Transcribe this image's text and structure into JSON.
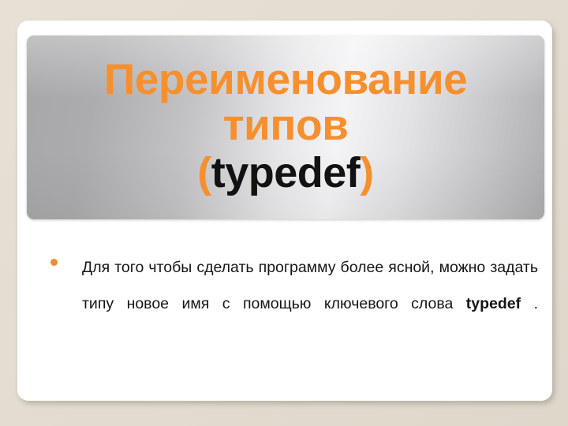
{
  "slide": {
    "background_color": "#e3ddd1",
    "card_color": "#ffffff",
    "accent_color": "#f6902f",
    "title_plate_gradient_from": "#a7a7a9",
    "title_plate_gradient_to": "#f4f4f6"
  },
  "title": {
    "line1": "Переименование",
    "line2": "типов",
    "line3_open_paren": "(",
    "line3_keyword": "typedef",
    "line3_close_paren": ")",
    "full_text": "Переименование типов (typedef)"
  },
  "body": {
    "bullets": [
      {
        "marker": "bullet-dot",
        "text_before_keyword": "Для того чтобы сделать программу более ясной, можно задать типу новое имя с помощью ключевого слова ",
        "keyword": "typedef",
        "text_after_keyword": " .",
        "full_text": "Для того чтобы сделать программу более ясной, можно задать типу новое имя с помощью ключевого слова typedef ."
      }
    ]
  }
}
